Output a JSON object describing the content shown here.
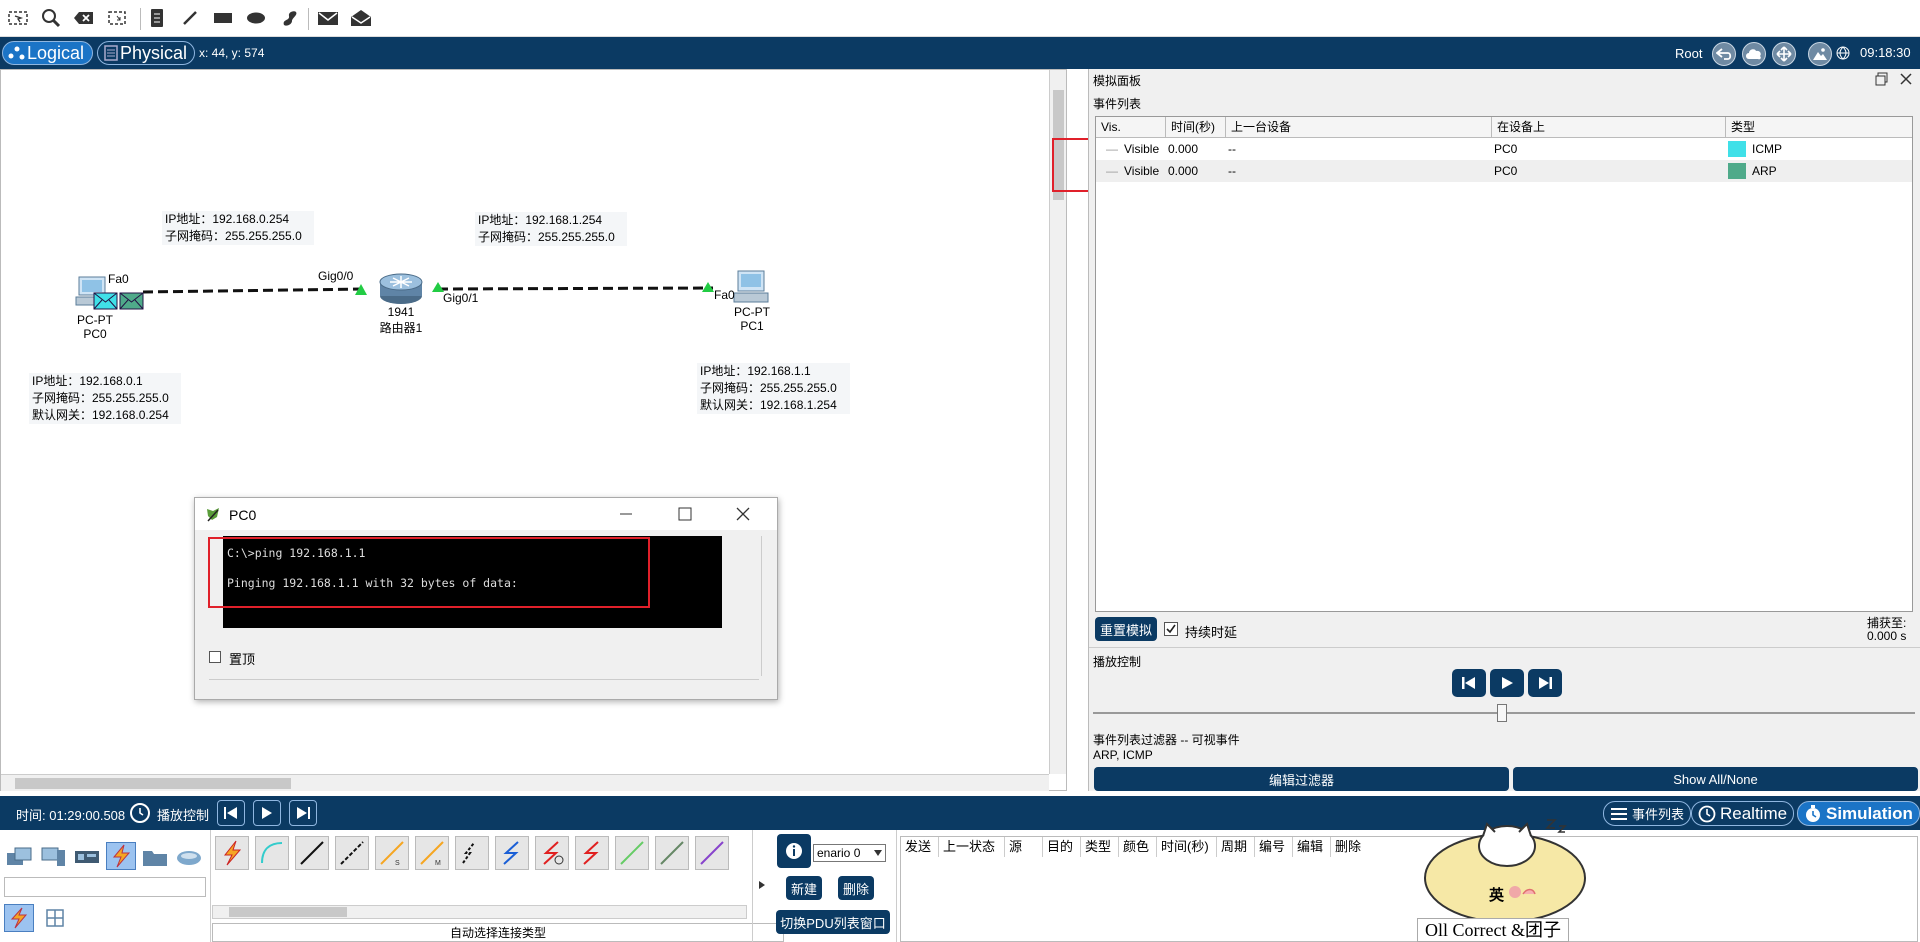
{
  "toolbar": {
    "icons": [
      "select-icon",
      "zoom-icon",
      "delete-icon",
      "resize-icon",
      "note-icon",
      "draw-line-icon",
      "rectangle-icon",
      "ellipse-icon",
      "freeform-icon",
      "simple-pdu-icon",
      "complex-pdu-icon"
    ]
  },
  "topbar": {
    "logical_label": "Logical",
    "physical_label": "Physical",
    "coords": "x: 44, y: 574",
    "root_label": "Root",
    "clock": "09:18:30"
  },
  "workspace": {
    "labels": {
      "router_ip_left": "IP地址：192.168.0.254",
      "router_mask_left": "子网掩码：255.255.255.0",
      "router_ip_right": "IP地址：192.168.1.254",
      "router_mask_right": "子网掩码：255.255.255.0",
      "pc0_ip": "IP地址：192.168.0.1",
      "pc0_mask": "子网掩码：255.255.255.0",
      "pc0_gw": "默认网关：192.168.0.254",
      "pc1_ip": "IP地址：192.168.1.1",
      "pc1_mask": "子网掩码：255.255.255.0",
      "pc1_gw": "默认网关：192.168.1.254"
    },
    "devices": {
      "pc0_type": "PC-PT",
      "pc0_name": "PC0",
      "pc0_port": "Fa0",
      "router_model": "1941",
      "router_name": "路由器1",
      "router_port_left": "Gig0/0",
      "router_port_right": "Gig0/1",
      "pc1_type": "PC-PT",
      "pc1_name": "PC1",
      "pc1_port": "Fa0"
    }
  },
  "cmd_window": {
    "title": "PC0",
    "line1": "C:\\>ping 192.168.1.1",
    "line2": "Pinging 192.168.1.1 with 32 bytes of data:",
    "top_checkbox_label": "置顶",
    "top_checked": false
  },
  "sim_panel": {
    "title": "模拟面板",
    "event_list_label": "事件列表",
    "columns": [
      "Vis.",
      "时间(秒)",
      "上一台设备",
      "在设备上",
      "类型"
    ],
    "events": [
      {
        "vis": "Visible",
        "time": "0.000",
        "last": "--",
        "at": "PC0",
        "type": "ICMP",
        "color": "#40e0e8"
      },
      {
        "vis": "Visible",
        "time": "0.000",
        "last": "--",
        "at": "PC0",
        "type": "ARP",
        "color": "#4faa8a"
      }
    ],
    "reset_label": "重置模拟",
    "constant_delay_label": "持续时延",
    "constant_delay_checked": true,
    "captured_label": "捕获至:",
    "captured_value": "0.000 s",
    "playback_label": "播放控制",
    "filter_title": "事件列表过滤器 -- 可视事件",
    "filter_value": "ARP, ICMP",
    "edit_filter_label": "编辑过滤器",
    "show_all_label": "Show All/None"
  },
  "timebar": {
    "time": "时间: 01:29:00.508",
    "playback": "播放控制",
    "event_list_btn": "事件列表",
    "realtime_label": "Realtime",
    "simulation_label": "Simulation"
  },
  "bottom": {
    "auto_conn_label": "自动选择连接类型",
    "scenario_value": "enario 0",
    "new_label": "新建",
    "delete_label": "删除",
    "toggle_pdu_label": "切换PDU列表窗口",
    "pdu_columns": [
      "发送",
      "上一状态",
      "源",
      "目的",
      "类型",
      "颜色",
      "时间(秒)",
      "周期",
      "编号",
      "编辑",
      "删除"
    ],
    "watermark_text": "Oll Correct &团子",
    "watermark_badge": "英"
  }
}
